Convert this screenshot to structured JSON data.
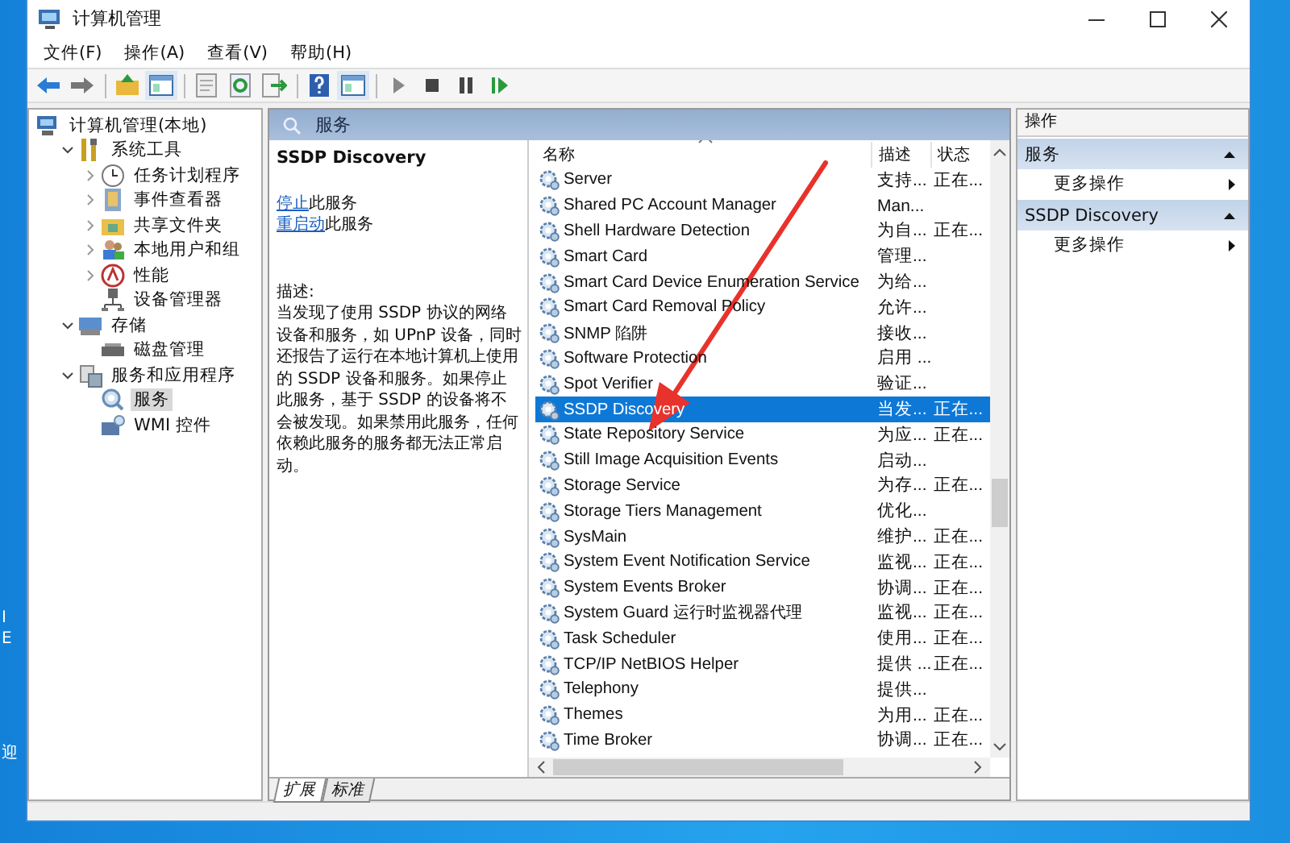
{
  "desktop": {
    "labels": [
      "I",
      "E",
      "迎"
    ]
  },
  "window": {
    "title": "计算机管理"
  },
  "menu": [
    "文件(F)",
    "操作(A)",
    "查看(V)",
    "帮助(H)"
  ],
  "toolbar": [
    {
      "kind": "back"
    },
    {
      "kind": "forward"
    },
    {
      "kind": "sep"
    },
    {
      "kind": "up"
    },
    {
      "kind": "pane"
    },
    {
      "kind": "sep"
    },
    {
      "kind": "props"
    },
    {
      "kind": "refresh"
    },
    {
      "kind": "export"
    },
    {
      "kind": "sep"
    },
    {
      "kind": "help"
    },
    {
      "kind": "pane"
    },
    {
      "kind": "sep"
    },
    {
      "kind": "play"
    },
    {
      "kind": "stop"
    },
    {
      "kind": "pause"
    },
    {
      "kind": "resume"
    }
  ],
  "tree": [
    {
      "label": "计算机管理(本地)",
      "selected": false,
      "children": [
        {
          "label": "系统工具",
          "expanded": true,
          "selected": false,
          "children": [
            {
              "label": "任务计划程序",
              "expanded": false,
              "selected": false
            },
            {
              "label": "事件查看器",
              "expanded": false,
              "selected": false
            },
            {
              "label": "共享文件夹",
              "expanded": false,
              "selected": false
            },
            {
              "label": "本地用户和组",
              "expanded": false,
              "selected": false
            },
            {
              "label": "性能",
              "expanded": false,
              "selected": false
            },
            {
              "label": "设备管理器",
              "selected": false
            }
          ]
        },
        {
          "label": "存储",
          "expanded": true,
          "selected": false,
          "children": [
            {
              "label": "磁盘管理",
              "selected": false
            }
          ]
        },
        {
          "label": "服务和应用程序",
          "expanded": true,
          "selected": false,
          "children": [
            {
              "label": "服务",
              "selected": true
            },
            {
              "label": "WMI 控件",
              "selected": false
            }
          ]
        }
      ]
    }
  ],
  "services": {
    "header": "服务",
    "detail": {
      "title": "SSDP Discovery",
      "links": [
        {
          "link": "停止",
          "rest": "此服务"
        },
        {
          "link": "重启动",
          "rest": "此服务"
        }
      ],
      "description_label": "描述:",
      "description": "当发现了使用 SSDP 协议的网络设备和服务，如 UPnP 设备，同时还报告了运行在本地计算机上使用的 SSDP 设备和服务。如果停止此服务，基于 SSDP 的设备将不会被发现。如果禁用此服务，任何依赖此服务的服务都无法正常启动。"
    },
    "columns": [
      "名称",
      "描述",
      "状态"
    ],
    "rows": [
      {
        "name": "Server",
        "description": "支持...",
        "status": "正在...",
        "selected": false
      },
      {
        "name": "Shared PC Account Manager",
        "description": "Man...",
        "selected": false
      },
      {
        "name": "Shell Hardware Detection",
        "description": "为自...",
        "status": "正在...",
        "selected": false
      },
      {
        "name": "Smart Card",
        "description": "管理...",
        "selected": false
      },
      {
        "name": "Smart Card Device Enumeration Service",
        "description": "为给...",
        "selected": false
      },
      {
        "name": "Smart Card Removal Policy",
        "description": "允许...",
        "selected": false
      },
      {
        "name": "SNMP 陷阱",
        "description": "接收...",
        "selected": false
      },
      {
        "name": "Software Protection",
        "description": "启用 ...",
        "selected": false
      },
      {
        "name": "Spot Verifier",
        "description": "验证...",
        "selected": false
      },
      {
        "name": "SSDP Discovery",
        "description": "当发...",
        "status": "正在...",
        "selected": true
      },
      {
        "name": "State Repository Service",
        "description": "为应...",
        "status": "正在...",
        "selected": false
      },
      {
        "name": "Still Image Acquisition Events",
        "description": "启动...",
        "selected": false
      },
      {
        "name": "Storage Service",
        "description": "为存...",
        "status": "正在...",
        "selected": false
      },
      {
        "name": "Storage Tiers Management",
        "description": "优化...",
        "selected": false
      },
      {
        "name": "SysMain",
        "description": "维护...",
        "status": "正在...",
        "selected": false
      },
      {
        "name": "System Event Notification Service",
        "description": "监视...",
        "status": "正在...",
        "selected": false
      },
      {
        "name": "System Events Broker",
        "description": "协调...",
        "status": "正在...",
        "selected": false
      },
      {
        "name": "System Guard 运行时监视器代理",
        "description": "监视...",
        "status": "正在...",
        "selected": false
      },
      {
        "name": "Task Scheduler",
        "description": "使用...",
        "status": "正在...",
        "selected": false
      },
      {
        "name": "TCP/IP NetBIOS Helper",
        "description": "提供 ...",
        "status": "正在...",
        "selected": false
      },
      {
        "name": "Telephony",
        "description": "提供...",
        "selected": false
      },
      {
        "name": "Themes",
        "description": "为用...",
        "status": "正在...",
        "selected": false
      },
      {
        "name": "Time Broker",
        "description": "协调...",
        "status": "正在...",
        "selected": false
      }
    ],
    "tabs": [
      {
        "label": "扩展",
        "selected": true
      },
      {
        "label": "标准",
        "selected": false
      }
    ]
  },
  "actions": {
    "header": "操作",
    "sections": [
      {
        "title": "服务",
        "items": [
          "更多操作"
        ]
      },
      {
        "title": "SSDP Discovery",
        "items": [
          "更多操作"
        ]
      }
    ]
  },
  "annotation": {
    "kind": "arrow"
  }
}
